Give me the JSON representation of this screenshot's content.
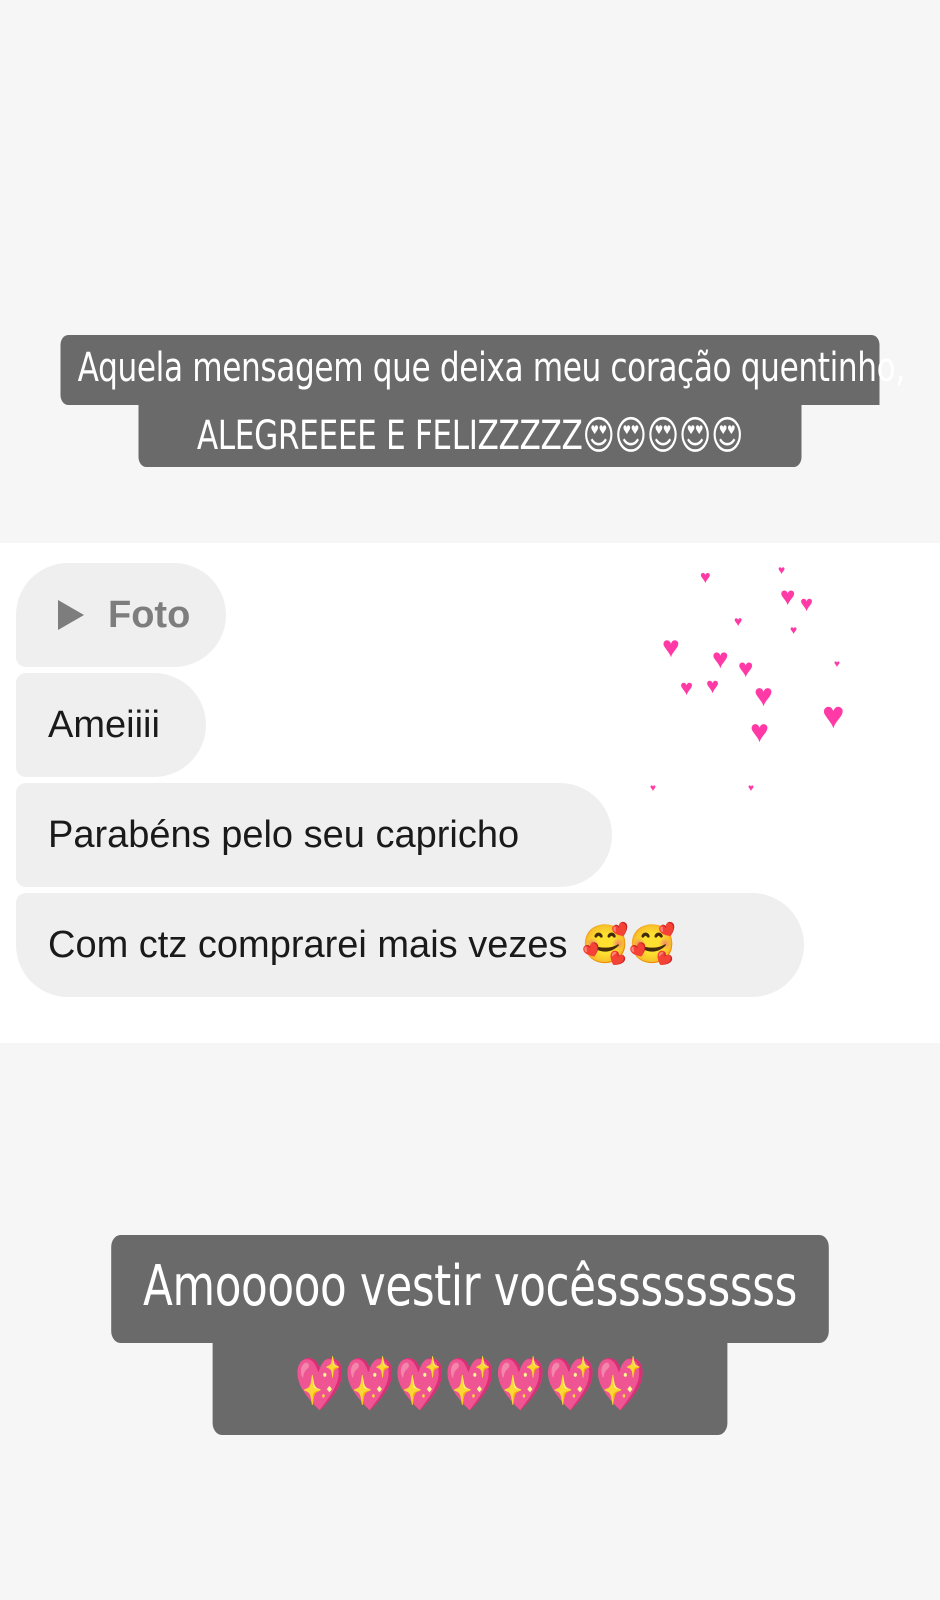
{
  "caption_top": {
    "line1": "Aquela mensagem que deixa meu coração quentinho,",
    "line2": "ALEGREEEE E FELIZZZZZ😍😍😍😍😍"
  },
  "messages": [
    {
      "label": "Foto",
      "icon": "play-icon"
    },
    {
      "text": "Ameiiii"
    },
    {
      "text": "Parabéns pelo seu capricho"
    },
    {
      "text": "Com ctz comprarei mais vezes",
      "emoji": "🥰🥰"
    }
  ],
  "caption_bottom": {
    "line1": "Amooooo vestir vocêsssssssss",
    "line2": "💖💖💖💖💖💖💖"
  },
  "colors": {
    "background": "#f6f6f6",
    "caption_bg": "#6a6a6a",
    "bubble_bg": "#efefef",
    "heart_pink": "#ff3aa6"
  }
}
